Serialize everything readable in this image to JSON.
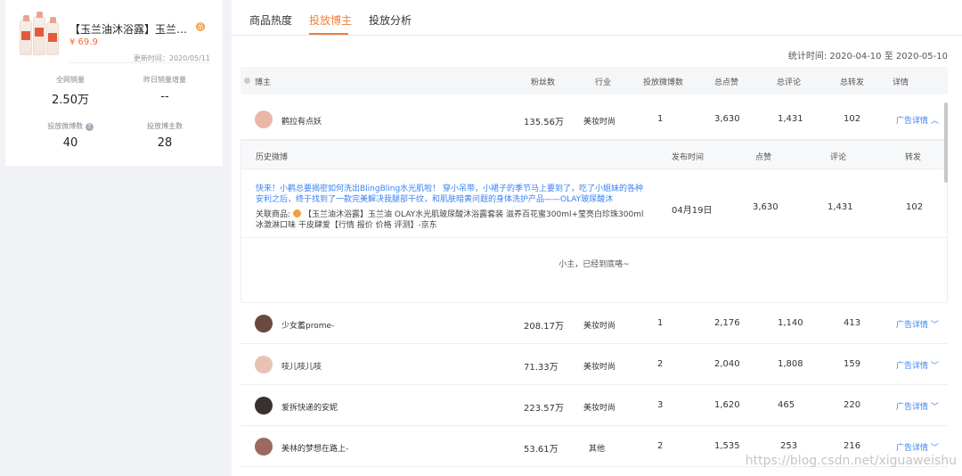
{
  "product": {
    "name": "【玉兰油沐浴露】玉兰油 OL...",
    "badge": "品",
    "price": "¥ 69.9",
    "update_time": "更新时间：2020/05/11",
    "stats": [
      {
        "label": "全网销量",
        "value": "2.50万"
      },
      {
        "label": "昨日销量增量",
        "value": "--"
      },
      {
        "label": "投放微博数",
        "value": "40"
      },
      {
        "label": "投放博主数",
        "value": "28"
      }
    ]
  },
  "tabs": [
    "商品热度",
    "投放博主",
    "投放分析"
  ],
  "active_tab": "投放博主",
  "stat_range": "统计时间: 2020-04-10 至 2020-05-10",
  "table": {
    "headers": [
      "博主",
      "粉丝数",
      "行业",
      "投放微博数",
      "总点赞",
      "总评论",
      "总转发",
      "详情"
    ],
    "rows": [
      {
        "name": "鹳拉有点妖",
        "fans": "135.56万",
        "industry": "美妆时尚",
        "posts": "1",
        "likes": "3,630",
        "comments": "1,431",
        "reposts": "102",
        "detail": "广告详情 ︿",
        "avatar": "#e9b7a8"
      },
      {
        "name": "少女蓄prome-",
        "fans": "208.17万",
        "industry": "美妆时尚",
        "posts": "1",
        "likes": "2,176",
        "comments": "1,140",
        "reposts": "413",
        "detail": "广告详情 ﹀",
        "avatar": "#6a4a3e"
      },
      {
        "name": "吱儿吱儿吱",
        "fans": "71.33万",
        "industry": "美妆时尚",
        "posts": "2",
        "likes": "2,040",
        "comments": "1,808",
        "reposts": "159",
        "detail": "广告详情 ﹀",
        "avatar": "#e8c2b4"
      },
      {
        "name": "爱拆快递的安妮",
        "fans": "223.57万",
        "industry": "美妆时尚",
        "posts": "3",
        "likes": "1,620",
        "comments": "465",
        "reposts": "220",
        "detail": "广告详情 ﹀",
        "avatar": "#3b3030"
      },
      {
        "name": "美林的梦想在路上-",
        "fans": "53.61万",
        "industry": "其他",
        "posts": "2",
        "likes": "1,535",
        "comments": "253",
        "reposts": "216",
        "detail": "广告详情 ﹀",
        "avatar": "#9a6a5e"
      }
    ]
  },
  "history": {
    "headers": [
      "历史微博",
      "发布时间",
      "点赞",
      "评论",
      "转发"
    ],
    "post_text": "快来！小鹳总要揭密如何洗出BlingBling水光肌啦！ 穿小吊带，小裙子的季节马上要到了，吃了小姐妹的各种安利之后，终于找到了一款完美解决我腿部干纹，和肌肤暗黄问题的身体洗护产品——OLAY玻尿酸沐",
    "related_label": "关联商品:",
    "related_text": "【玉兰油沐浴露】玉兰油 OLAY水光肌玻尿酸沐浴露套装 滋养百花蜜300ml+莹亮白珍珠300ml 冰激淋口味 干皮肆爱【行情 报价 价格 评测】-京东",
    "date": "04月19日",
    "likes": "3,630",
    "comments": "1,431",
    "reposts": "102",
    "end_text": "小主，已经到底咯~"
  },
  "watermark": "https://blog.csdn.net/xiguaweishu"
}
